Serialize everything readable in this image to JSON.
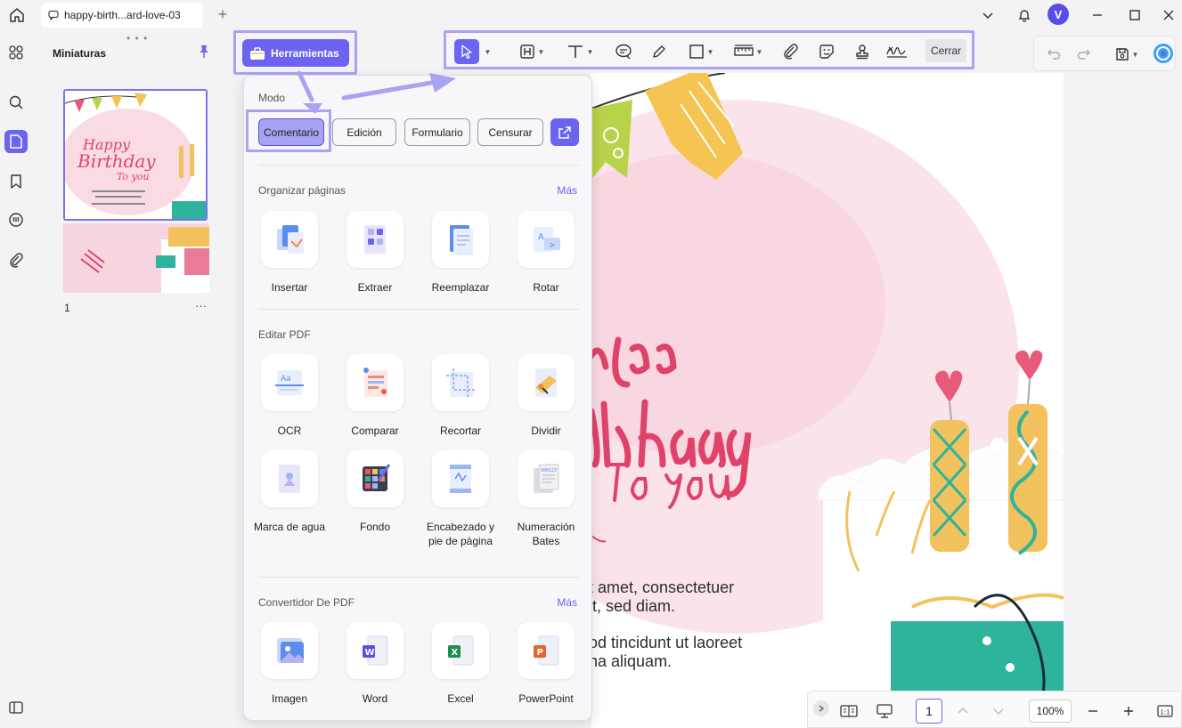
{
  "titlebar": {
    "tab_title": "happy-birth...ard-love-03",
    "avatar_initial": "V"
  },
  "thumbnails": {
    "title": "Miniaturas",
    "page_number": "1",
    "more": "···"
  },
  "tools_button": {
    "label": "Herramientas"
  },
  "toolbar": {
    "close_label": "Cerrar"
  },
  "panel": {
    "mode_title": "Modo",
    "modes": [
      {
        "label": "Comentario",
        "active": true
      },
      {
        "label": "Edición",
        "active": false
      },
      {
        "label": "Formulario",
        "active": false
      },
      {
        "label": "Censurar",
        "active": false
      }
    ],
    "organize": {
      "title": "Organizar páginas",
      "more": "Más",
      "items": [
        "Insertar",
        "Extraer",
        "Reemplazar",
        "Rotar"
      ]
    },
    "edit": {
      "title": "Editar PDF",
      "items": [
        "OCR",
        "Comparar",
        "Recortar",
        "Dividir"
      ],
      "items2": [
        "Marca de agua",
        "Fondo",
        "Encabezado y pie de página",
        "Numeración Bates"
      ]
    },
    "convert": {
      "title": "Convertidor De PDF",
      "more": "Más",
      "items": [
        "Imagen",
        "Word",
        "Excel",
        "PowerPoint"
      ]
    }
  },
  "document": {
    "line1": "t amet, consectetuer",
    "line2": "it, sed diam.",
    "line3": "od tincidunt ut laoreet",
    "line4": "na aliquam."
  },
  "statusbar": {
    "page": "1",
    "zoom": "100%"
  },
  "colors": {
    "accent": "#6c63f0",
    "highlight": "#a9a3f3"
  }
}
